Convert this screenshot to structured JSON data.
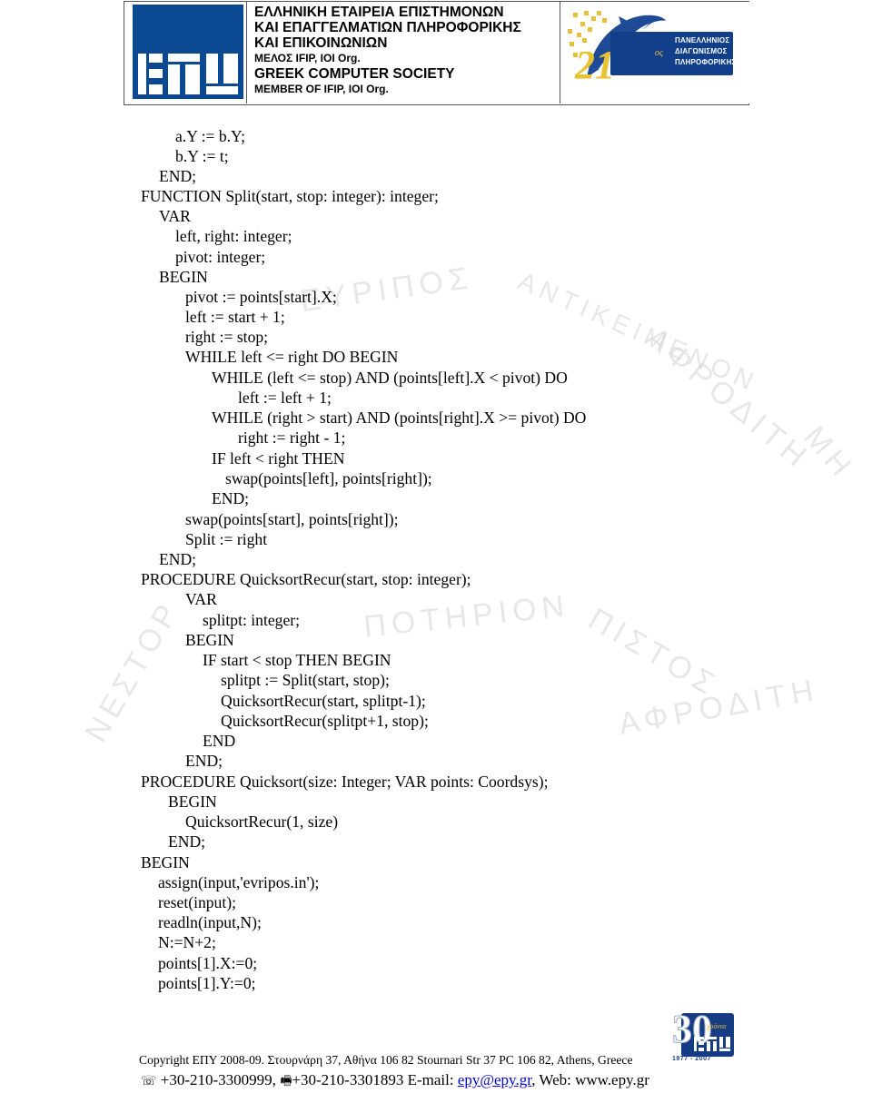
{
  "header": {
    "org_lines": [
      "ΕΛΛΗΝΙΚΗ  ΕΤΑΙΡΕΙΑ  ΕΠΙΣΤΗΜΟΝΩΝ",
      "ΚΑΙ ΕΠΑΓΓΕΛΜΑΤΙΩΝ  ΠΛΗΡΟΦΟΡΙΚΗΣ",
      "ΚΑΙ ΕΠΙΚΟΙΝΩΝΙΩΝ",
      "ΜΕΛΟΣ IFIP, IOI Org.",
      "GREEK COMPUTER SOCIETY",
      "MEMBER OF IFIP, IOI Org."
    ],
    "contest": {
      "number": "21",
      "suffix": "ος",
      "lines": [
        "ΠΑΝΕΛΛΗΝΙΟΣ",
        "ΔΙΑΓΩΝΙΣΜΟΣ",
        "ΠΛΗΡΟΦΟΡΙΚΗΣ"
      ]
    },
    "colors": {
      "brand_blue": "#0b4a92",
      "contest_gold": "#e7c232"
    }
  },
  "code_lines": [
    "a.Y := b.Y;",
    "b.Y := t;",
    "END;",
    "FUNCTION Split(start, stop: integer): integer;",
    "VAR",
    "left, right: integer;",
    "pivot: integer;",
    "BEGIN",
    "pivot := points[start].X;",
    "left := start + 1;",
    "right := stop;",
    "WHILE left <= right DO BEGIN",
    "WHILE (left <= stop) AND (points[left].X < pivot) DO",
    "left := left + 1;",
    "WHILE (right > start) AND (points[right].X >= pivot) DO",
    "right := right - 1;",
    "IF left < right THEN",
    "swap(points[left], points[right]);",
    "END;",
    "swap(points[start], points[right]);",
    "Split := right",
    "END;",
    "PROCEDURE QuicksortRecur(start, stop: integer);",
    "VAR",
    "splitpt: integer;",
    "BEGIN",
    "IF start < stop THEN BEGIN",
    "splitpt := Split(start, stop);",
    "QuicksortRecur(start, splitpt-1);",
    "QuicksortRecur(splitpt+1, stop);",
    "END",
    "END;",
    "PROCEDURE Quicksort(size: Integer; VAR points: Coordsys);",
    "BEGIN",
    "QuicksortRecur(1, size)",
    "END;",
    "BEGIN",
    "assign(input,'evripos.in');",
    "reset(input);",
    "readln(input,N);",
    "N:=N+2;",
    "points[1].X:=0;",
    "points[1].Y:=0;"
  ],
  "watermark": {
    "texts": [
      "ΕΥΡΙΠΟΣ",
      "ΑΝΤΙΚΕΙΜΕΝΟΝ",
      "ΑΦΡΟΔΙΤΗ",
      "ΜΗ",
      "ΝΕΣΤΟΡ",
      "ΠΟΤΗΡΙΟΝ",
      "ΠΙΣΤΟΣ"
    ]
  },
  "footer": {
    "copyright": "Copyright ΕΠΥ 2008-09. Στουρνάρη 37, Αθήνα 106 82 Stournari Str 37 PC 106 82, Athens, Greece",
    "phone_icon": "☏",
    "phone": " +30-210-3300999, ",
    "fax_icon": "🖷",
    "fax": "+30-210-3301893 E-mail: ",
    "email": "epy@epy.gr",
    "web": ", Web: www.epy.gr",
    "anniversary": {
      "number": "30",
      "label": "χρόνια",
      "years": "1977 - 2007"
    }
  }
}
